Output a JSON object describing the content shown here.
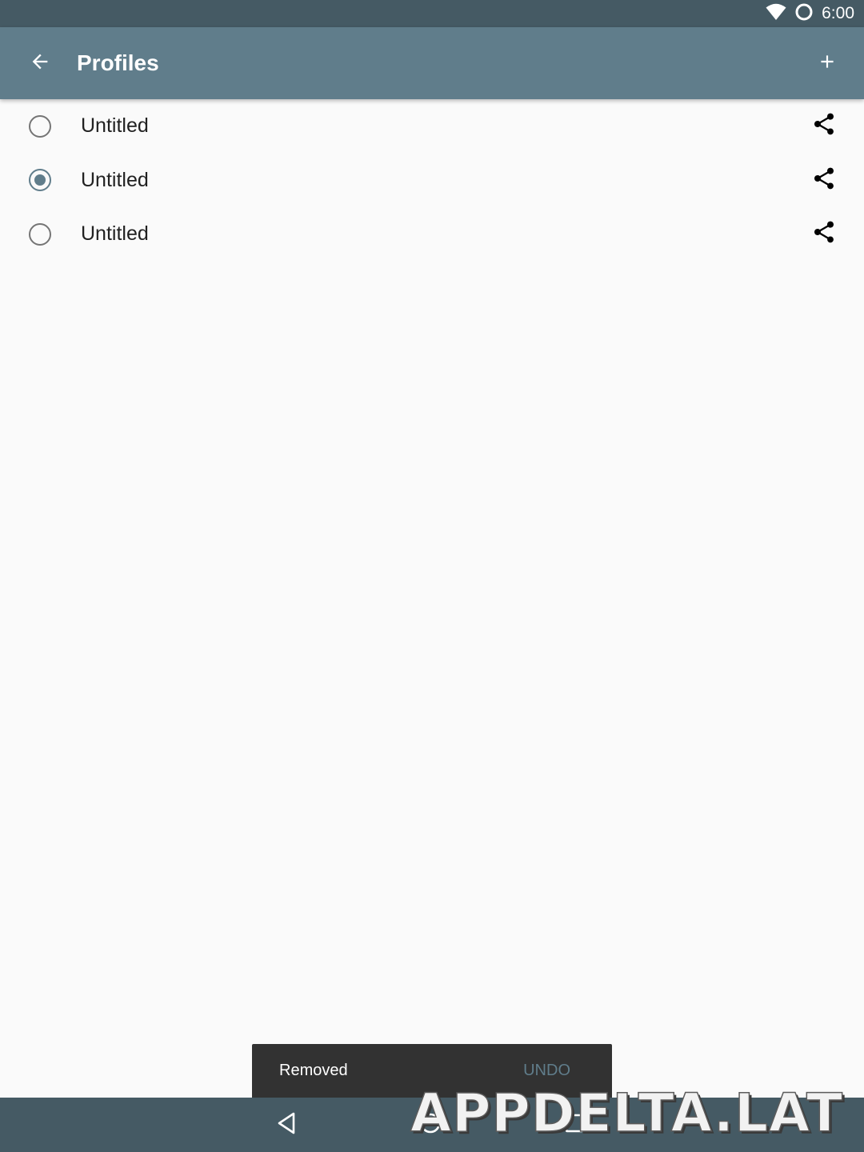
{
  "status_bar": {
    "time": "6:00",
    "icons": [
      "wifi-icon",
      "sync-circle-icon"
    ]
  },
  "app_bar": {
    "title": "Profiles",
    "back_icon": "arrow-back-icon",
    "add_icon": "plus-icon",
    "color": "#607d8b"
  },
  "profiles": [
    {
      "name": "Untitled",
      "selected": false
    },
    {
      "name": "Untitled",
      "selected": true
    },
    {
      "name": "Untitled",
      "selected": false
    }
  ],
  "snackbar": {
    "message": "Removed",
    "action": "UNDO"
  },
  "nav_bar": {
    "buttons": [
      "back-triangle-icon",
      "home-circle-icon",
      "recents-square-icon"
    ]
  },
  "watermark": {
    "text": "APPDELTA.LAT"
  },
  "colors": {
    "status_bar": "#455a64",
    "app_bar": "#607d8b",
    "background": "#fafafa",
    "snackbar": "#323232",
    "accent": "#607d8b"
  }
}
